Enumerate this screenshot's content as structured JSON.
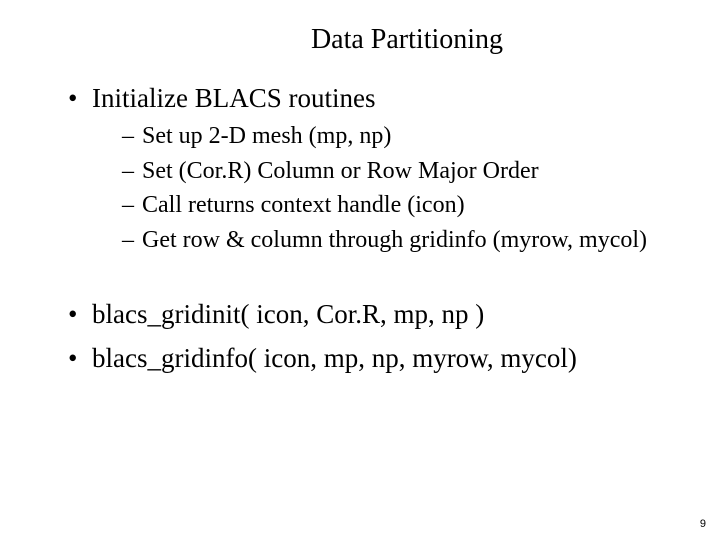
{
  "title": "Data Partitioning",
  "bullets": {
    "b1": "Initialize BLACS routines",
    "sub": {
      "s1": "Set up 2-D mesh (mp, np)",
      "s2": "Set (Cor.R) Column or Row Major Order",
      "s3": "Call returns context handle (icon)",
      "s4": "Get row & column through gridinfo (myrow, mycol)"
    },
    "b2": "blacs_gridinit( icon, Cor.R, mp, np )",
    "b3": "blacs_gridinfo( icon, mp, np, myrow, mycol)"
  },
  "page_number": "9"
}
